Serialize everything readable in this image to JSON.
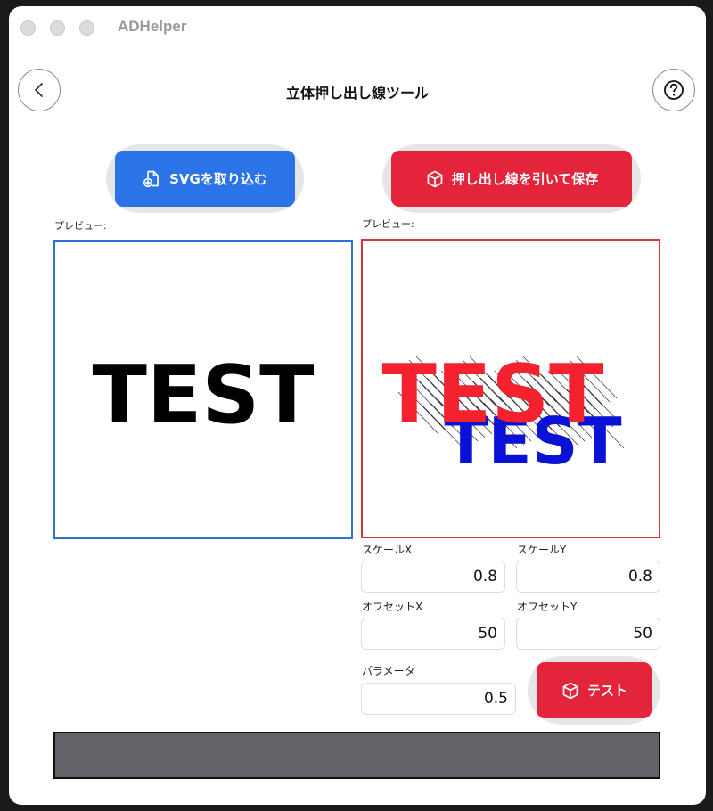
{
  "window": {
    "app_title": "ADHelper",
    "traffic_lights": [
      "close",
      "minimize",
      "zoom"
    ]
  },
  "header": {
    "back_icon": "chevron-left-icon",
    "title": "立体押し出し線ツール",
    "help_icon": "question-circle-icon"
  },
  "actions": {
    "import_label": "SVGを取り込む",
    "import_icon": "file-plus-icon",
    "extrude_label": "押し出し線を引いて保存",
    "extrude_icon": "cube-icon",
    "test_label": "テスト",
    "test_icon": "cube-icon"
  },
  "previews": {
    "left_label": "プレビュー:",
    "right_label": "プレビュー:",
    "source_text": "TEST",
    "front_text": "TEST",
    "back_text": "TEST",
    "front_color": "#f4212f",
    "back_color": "#0a12d6"
  },
  "params": {
    "scale_x_label": "スケールX",
    "scale_x_value": "0.8",
    "scale_y_label": "スケールY",
    "scale_y_value": "0.8",
    "offset_x_label": "オフセットX",
    "offset_x_value": "50",
    "offset_y_label": "オフセットY",
    "offset_y_value": "50",
    "param_label": "パラメータ",
    "param_value": "0.5"
  },
  "colors": {
    "accent_blue": "#2a74e8",
    "accent_red": "#e3243b",
    "status_bar": "#636369"
  }
}
